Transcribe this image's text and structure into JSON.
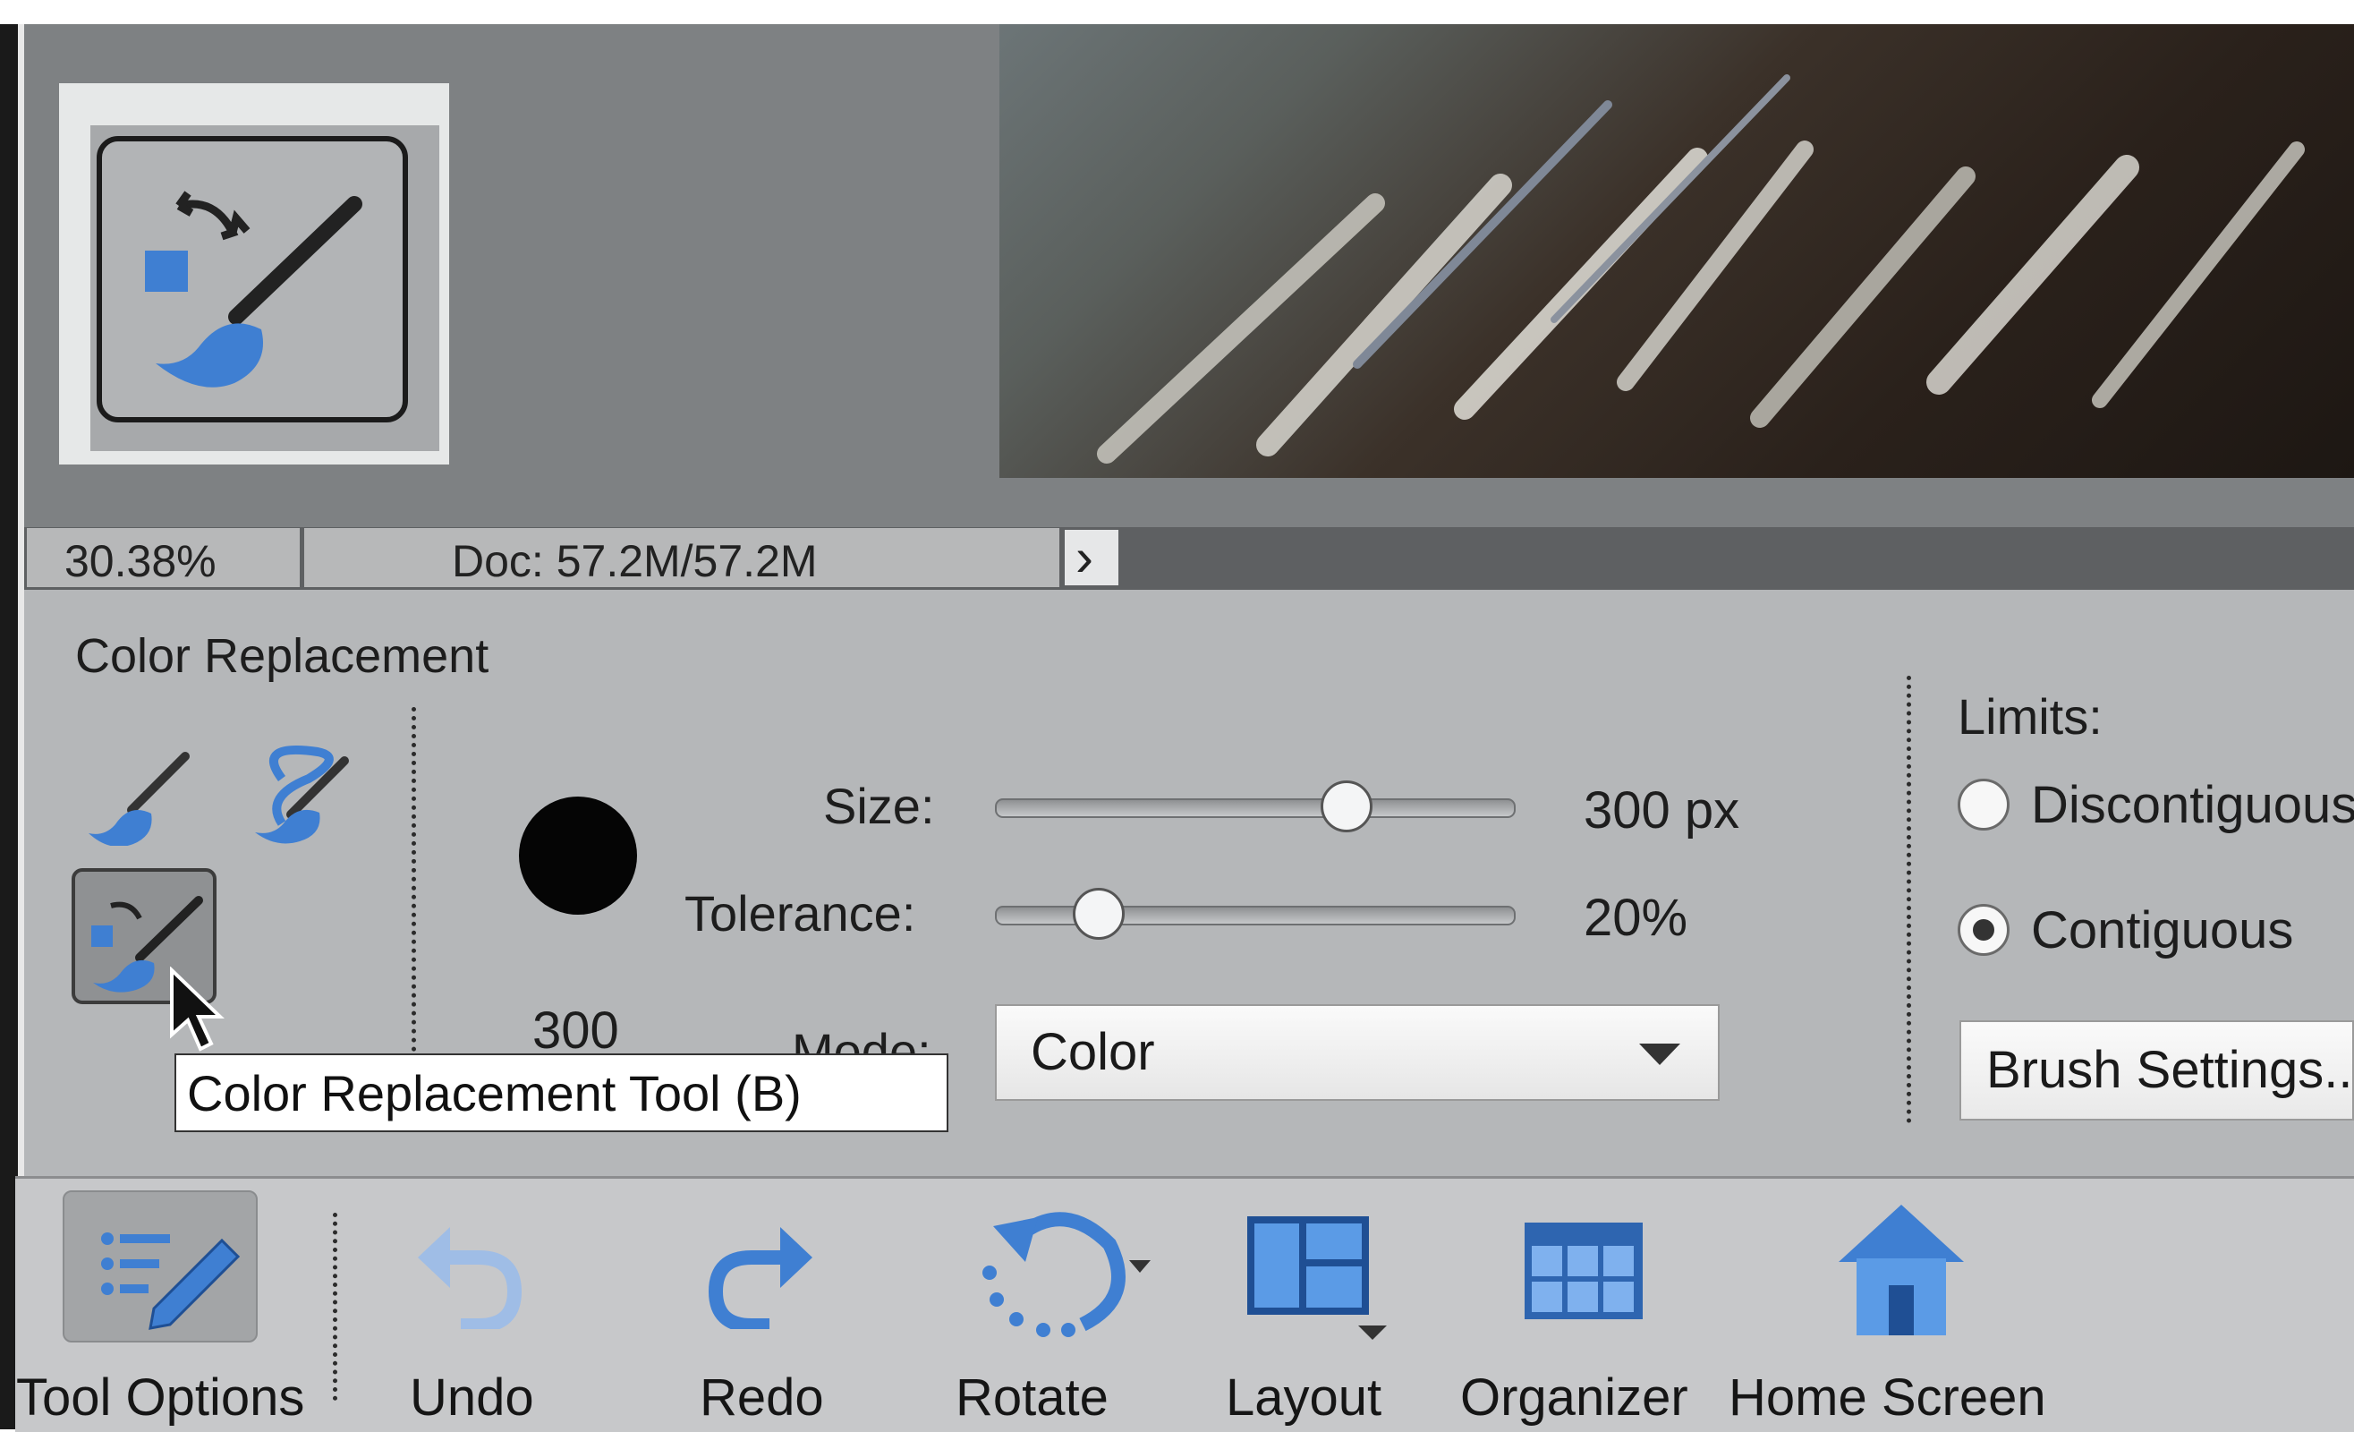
{
  "status": {
    "zoom": "30.38%",
    "doc": "Doc: 57.2M/57.2M",
    "arrow": "›"
  },
  "options": {
    "title": "Color Replacement",
    "brush_size_value": "300",
    "size_label": "Size:",
    "size_value": "300 px",
    "size_fraction": 0.68,
    "tolerance_label": "Tolerance:",
    "tolerance_value": "20%",
    "tolerance_fraction": 0.2,
    "mode_label": "Mode:",
    "mode_value": "Color",
    "limits_label": "Limits:",
    "limits_options": [
      "Discontiguous",
      "Contiguous"
    ],
    "limits_selected": "Contiguous",
    "brush_settings_label": "Brush Settings...",
    "tooltip": "Color Replacement Tool (B)"
  },
  "taskbar": {
    "items": [
      {
        "label": "Tool Options",
        "icon": "tool-options-icon"
      },
      {
        "label": "Undo",
        "icon": "undo-icon"
      },
      {
        "label": "Redo",
        "icon": "redo-icon"
      },
      {
        "label": "Rotate",
        "icon": "rotate-icon"
      },
      {
        "label": "Layout",
        "icon": "layout-icon"
      },
      {
        "label": "Organizer",
        "icon": "organizer-icon"
      },
      {
        "label": "Home Screen",
        "icon": "home-icon"
      }
    ]
  },
  "colors": {
    "icon_blue": "#3f7fd2",
    "panel_gray": "#b5b7b9"
  }
}
